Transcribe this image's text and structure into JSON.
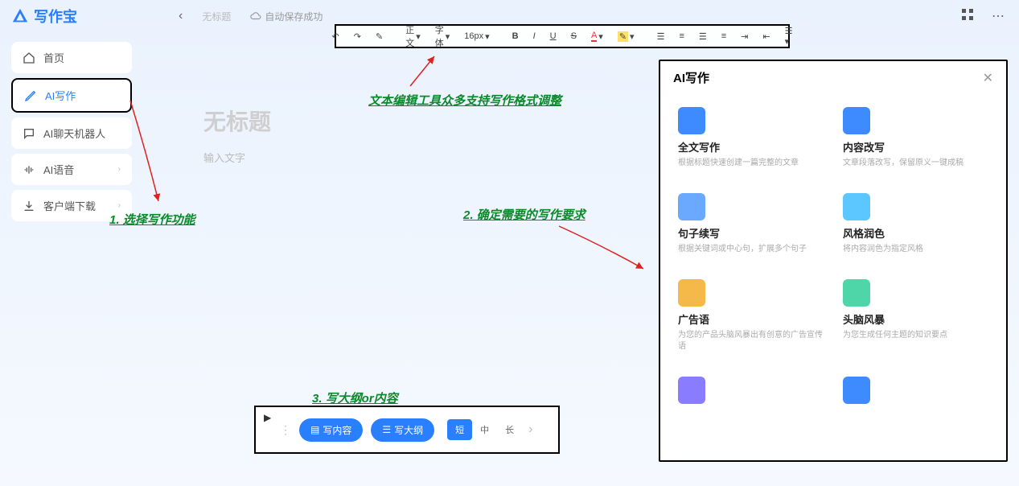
{
  "app": {
    "name": "写作宝"
  },
  "header": {
    "crumb": "无标题",
    "autosave": "自动保存成功"
  },
  "sidebar": {
    "items": [
      {
        "label": "首页"
      },
      {
        "label": "AI写作"
      },
      {
        "label": "AI聊天机器人"
      },
      {
        "label": "AI语音"
      },
      {
        "label": "客户端下载"
      }
    ]
  },
  "toolbar": {
    "format_label": "正文",
    "font_label": "字体",
    "size_label": "16px"
  },
  "editor": {
    "title_placeholder": "无标题",
    "body_placeholder": "输入文字"
  },
  "ai_panel": {
    "title": "AI写作",
    "cards": [
      {
        "title": "全文写作",
        "desc": "根据标题快速创建一篇完整的文章",
        "color": "#3d8bff"
      },
      {
        "title": "内容改写",
        "desc": "文章段落改写，保留原义一键成稿",
        "color": "#3d8bff"
      },
      {
        "title": "句子续写",
        "desc": "根据关键词或中心句，扩展多个句子",
        "color": "#6aa9ff"
      },
      {
        "title": "风格润色",
        "desc": "将内容润色为指定风格",
        "color": "#5bc6ff"
      },
      {
        "title": "广告语",
        "desc": "为您的产品头脑风暴出有创意的广告宣传语",
        "color": "#f5b94a"
      },
      {
        "title": "头脑风暴",
        "desc": "为您生成任何主题的知识要点",
        "color": "#4fd6a8"
      },
      {
        "title": "",
        "desc": "",
        "color": "#8a7cff"
      },
      {
        "title": "",
        "desc": "",
        "color": "#3d8bff"
      }
    ]
  },
  "bottom": {
    "write_content": "写内容",
    "write_outline": "写大纲",
    "len_short": "短",
    "len_mid": "中",
    "len_long": "长"
  },
  "annotations": {
    "a1": "1. 选择写作功能",
    "a2": "2. 确定需要的写作要求",
    "a3": "3. 写大纲or内容",
    "a_toolbar": "文本编辑工具众多支持写作格式调整"
  }
}
